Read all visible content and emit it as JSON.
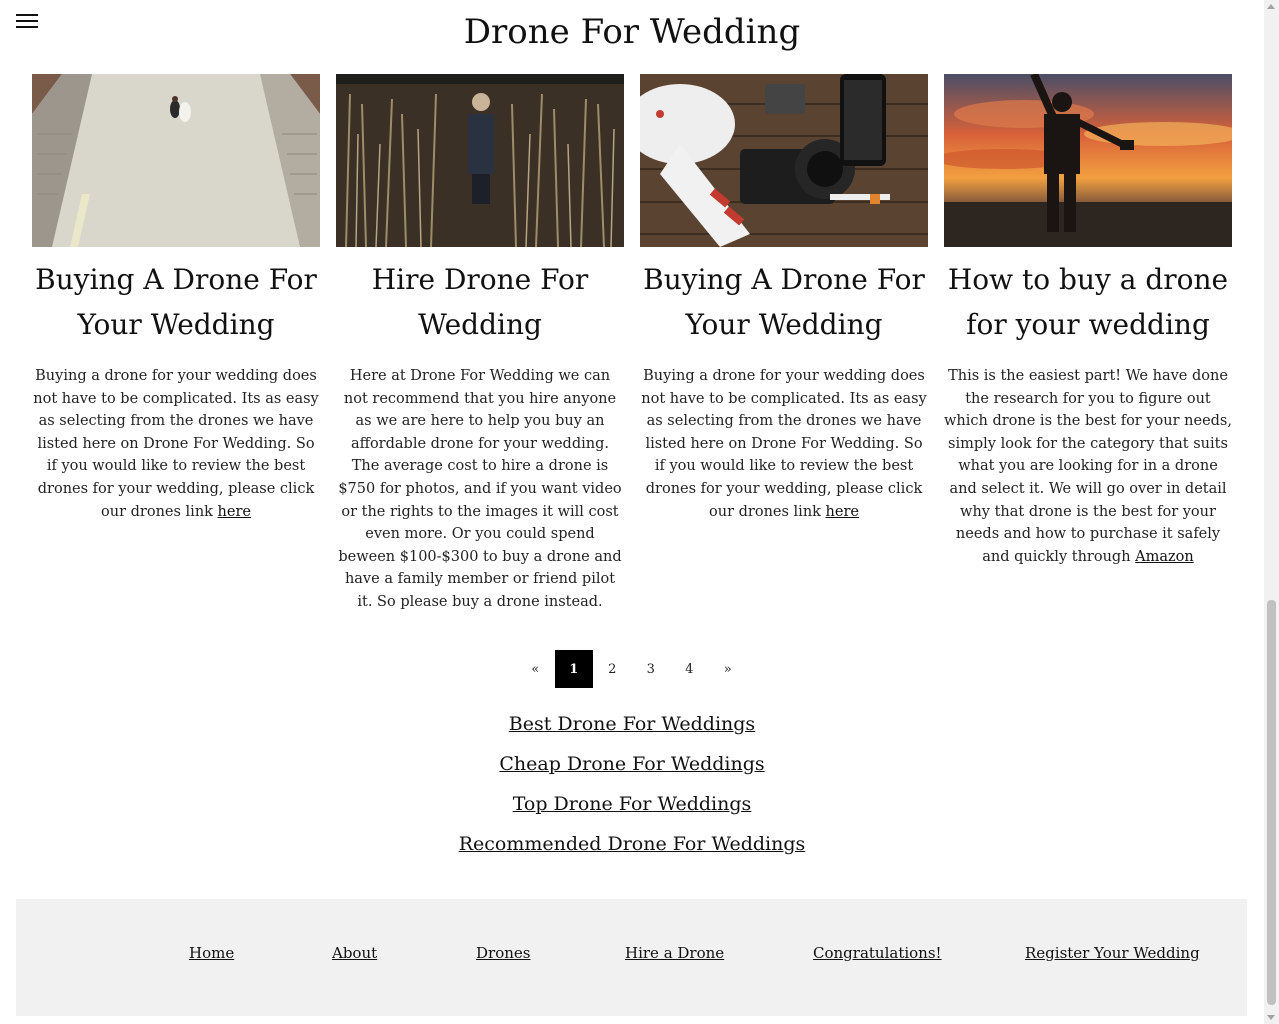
{
  "header": {
    "title": "Drone For Wedding",
    "menu_icon": "hamburger-menu-icon"
  },
  "posts": [
    {
      "title": "Buying A Drone For Your Wedding",
      "body": "Buying a drone for your wedding does not have to be complicated. Its as easy as selecting from the drones we have listed here on Drone For Wedding. So if you would like to review the best drones for your wedding, please click our drones link ",
      "link": "here",
      "image": "couple-on-stairs-aerial-photo"
    },
    {
      "title": "Hire Drone For Wedding",
      "body": "Here at Drone For Wedding we can not recommend that you hire anyone as we are here to help you buy an affordable drone for your wedding. The average cost to hire a drone is $750 for photos, and if you want video or the rights to the images it will cost even more. Or you could spend beween $100-$300 to buy a drone and have a family member or friend pilot it. So please buy a drone instead.",
      "link": "",
      "image": "person-in-tall-grass-photo"
    },
    {
      "title": "Buying A Drone For Your Wedding",
      "body": "Buying a drone for your wedding does not have to be complicated. Its as easy as selecting from the drones we have listed here on Drone For Wedding. So if you would like to review the best drones for your wedding, please click our drones link ",
      "link": "here",
      "image": "drone-and-camera-on-table-photo"
    },
    {
      "title": "How to buy a drone for your wedding",
      "body": "This is the easiest part! We have done the research for you to figure out which drone is the best for your needs, simply look for the category that suits what you are looking for in a drone and select it. We will go over in detail why that drone is the best for your needs and how to purchase it safely and quickly through ",
      "link": "Amazon",
      "image": "man-flying-drone-sunset-photo"
    }
  ],
  "pagination": {
    "prev": "«",
    "pages": [
      "1",
      "2",
      "3",
      "4"
    ],
    "current": "1",
    "next": "»"
  },
  "related_links": [
    "Best Drone For Weddings",
    "Cheap Drone For Weddings",
    "Top Drone For Weddings",
    "Recommended Drone For Weddings"
  ],
  "footer": {
    "links": [
      "Home",
      "About",
      "Drones",
      "Hire a Drone",
      "Congratulations!",
      "Register Your Wedding"
    ]
  }
}
